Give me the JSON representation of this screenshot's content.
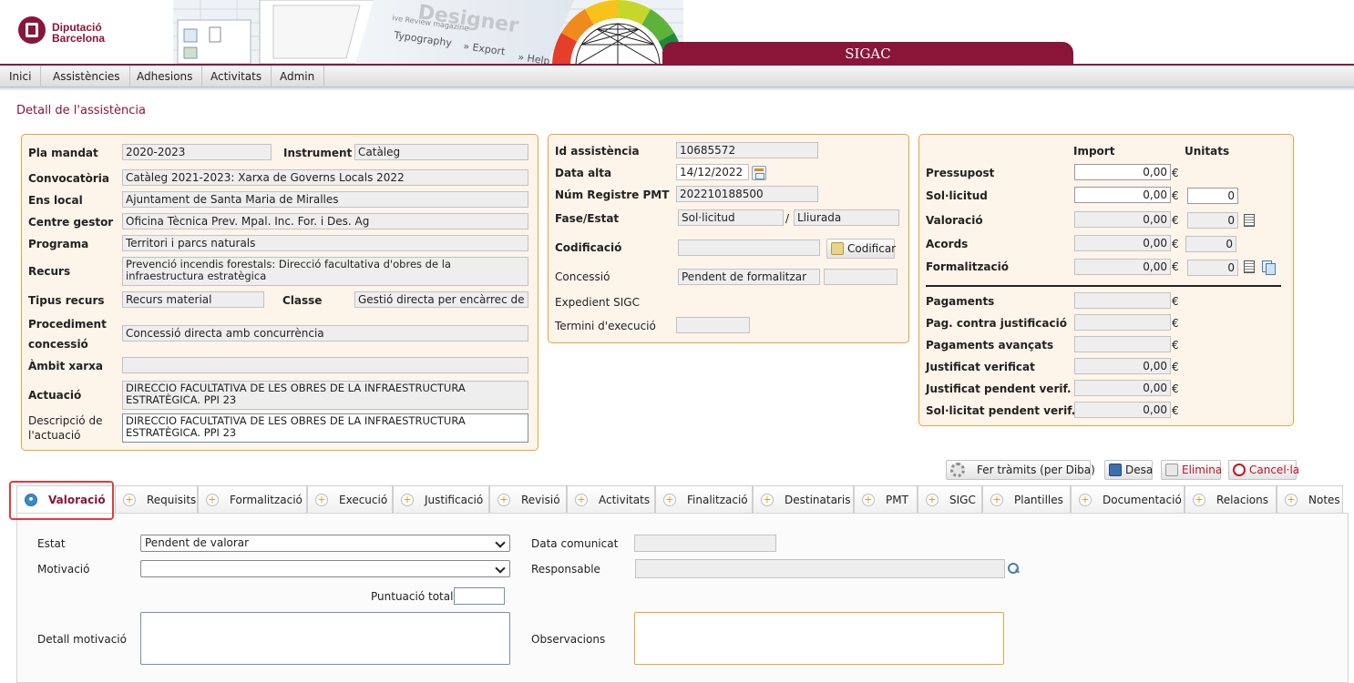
{
  "brand": {
    "line1": "Diputació",
    "line2": "Barcelona",
    "color": "#8a1538"
  },
  "header": {
    "app_title": "SIGAC",
    "banner_words": [
      "Designer",
      "ive Review magazine",
      "Typography",
      "» Export",
      "» Help"
    ]
  },
  "menu": [
    "Inici",
    "Assistències",
    "Adhesions",
    "Activitats",
    "Admin"
  ],
  "page_title": "Detall de l'assistència",
  "left_panel": {
    "pla_mandat": {
      "label": "Pla mandat",
      "value": "2020-2023"
    },
    "instrument": {
      "label": "Instrument",
      "value": "Catàleg"
    },
    "convocatoria": {
      "label": "Convocatòria",
      "value": "Catàleg 2021-2023: Xarxa de Governs Locals 2022"
    },
    "ens_local": {
      "label": "Ens local",
      "value": "Ajuntament de Santa Maria de Miralles"
    },
    "centre_gestor": {
      "label": "Centre gestor",
      "value": "Oficina Tècnica Prev. Mpal. Inc. For. i Des. Ag"
    },
    "programa": {
      "label": "Programa",
      "value": "Territori i parcs naturals"
    },
    "recurs": {
      "label": "Recurs",
      "value": "Prevenció incendis forestals: Direcció facultativa d'obres de la infraestructura estratègica"
    },
    "tipus_recurs": {
      "label": "Tipus recurs",
      "value": "Recurs material"
    },
    "classe": {
      "label": "Classe",
      "value": "Gestió directa per encàrrec de l'e"
    },
    "procediment": {
      "label1": "Procediment",
      "label2": "concessió",
      "value": "Concessió directa amb concurrència"
    },
    "ambit_xarxa": {
      "label": "Àmbit xarxa",
      "value": ""
    },
    "actuacio": {
      "label": "Actuació",
      "value": "DIRECCIO FACULTATIVA  DE LES OBRES DE LA INFRAESTRUCTURA ESTRATÈGICA. PPI 23"
    },
    "descripcio": {
      "label1": "Descripció de",
      "label2": "l'actuació",
      "value": "DIRECCIO FACULTATIVA  DE LES OBRES DE LA INFRAESTRUCTURA ESTRATÈGICA. PPI 23"
    }
  },
  "mid_panel": {
    "id_assistencia": {
      "label": "Id assistència",
      "value": "10685572"
    },
    "data_alta": {
      "label": "Data alta",
      "value": "14/12/2022"
    },
    "num_registre": {
      "label": "Núm Registre PMT",
      "value": "202210188500"
    },
    "fase_estat": {
      "label": "Fase/Estat",
      "fase": "Sol·licitud",
      "sep": "/",
      "estat": "Lliurada"
    },
    "codificacio": {
      "label": "Codificació",
      "value": "",
      "button": "Codificar"
    },
    "concessio": {
      "label": "Concessió",
      "value": "Pendent de formalitzar",
      "value2": ""
    },
    "expedient": {
      "label": "Expedient SIGC"
    },
    "termini": {
      "label": "Termini d'execució",
      "value": ""
    }
  },
  "right_panel": {
    "col_import": "Import",
    "col_unitats": "Unitats",
    "currency": "€",
    "rows_top": [
      {
        "label": "Pressupost",
        "import": "0,00",
        "unitats": null,
        "editable": true
      },
      {
        "label": "Sol·licitud",
        "import": "0,00",
        "unitats": "0",
        "editable": true
      },
      {
        "label": "Valoració",
        "import": "0,00",
        "unitats": "0",
        "editable": false
      },
      {
        "label": "Acords",
        "import": "0,00",
        "unitats": "0",
        "editable": false
      },
      {
        "label": "Formalització",
        "import": "0,00",
        "unitats": "0",
        "editable": false
      }
    ],
    "rows_bottom": [
      {
        "label": "Pagaments",
        "import": ""
      },
      {
        "label": "Pag. contra justificació",
        "import": ""
      },
      {
        "label": "Pagaments avançats",
        "import": ""
      },
      {
        "label": "Justificat verificat",
        "import": "0,00"
      },
      {
        "label": "Justificat pendent verif.",
        "import": "0,00"
      },
      {
        "label": "Sol·licitat pendent verif.",
        "import": "0,00"
      }
    ]
  },
  "actions": {
    "tramits": "Fer tràmits (per Diba)",
    "save": "Desa",
    "delete": "Elimina",
    "cancel": "Cancel·la"
  },
  "tabs": [
    "Valoració",
    "Requisits",
    "Formalització",
    "Execució",
    "Justificació",
    "Revisió",
    "Activitats",
    "Finalització",
    "Destinataris",
    "PMT",
    "SIGC",
    "Plantilles",
    "Documentació",
    "Relacions",
    "Notes"
  ],
  "active_tab": "Valoració",
  "valoracio_form": {
    "estat": {
      "label": "Estat",
      "value": "Pendent de valorar"
    },
    "motivacio": {
      "label": "Motivació",
      "value": ""
    },
    "puntuacio": {
      "label": "Puntuació total:",
      "value": ""
    },
    "detall": {
      "label": "Detall motivació",
      "value": ""
    },
    "data_comunicat": {
      "label": "Data comunicat",
      "value": ""
    },
    "responsable": {
      "label": "Responsable",
      "value": ""
    },
    "observacions": {
      "label": "Observacions",
      "value": ""
    }
  }
}
